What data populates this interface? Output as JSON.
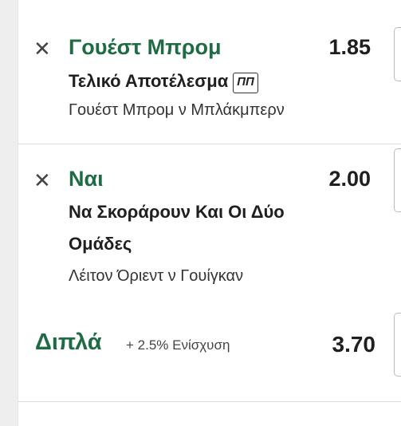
{
  "bets": [
    {
      "selection": "Γουέστ Μπρομ",
      "odds": "1.85",
      "market_line1": "Τελικό Αποτέλεσμα",
      "market_line2": "",
      "badge": "ΠΠ",
      "event": "Γουέστ Μπρομ ν Μπλάκμπερν"
    },
    {
      "selection": "Ναι",
      "odds": "2.00",
      "market_line1": "Να Σκοράρουν Και Οι Δύο",
      "market_line2": "Ομάδες",
      "badge": "",
      "event": "Λέιτον Όριεντ ν Γουίγκαν"
    }
  ],
  "double": {
    "label": "Διπλά",
    "boost": "+ 2.5% Ενίσχυση",
    "odds": "3.70"
  },
  "icons": {
    "remove": "close-icon"
  },
  "colors": {
    "selection_green": "#1e6b44",
    "text_dark": "#1f1f1f"
  }
}
